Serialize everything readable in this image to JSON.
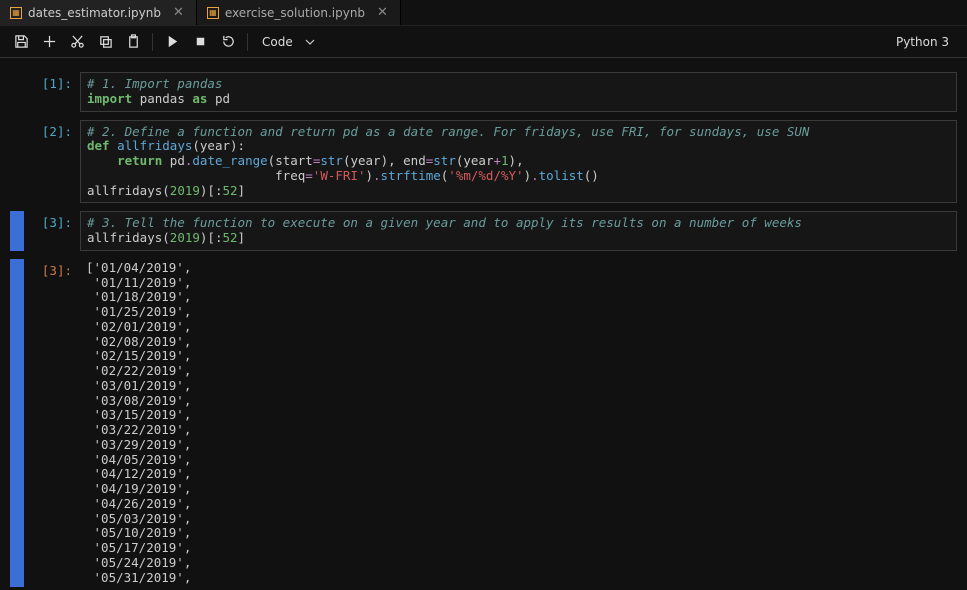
{
  "tabs": [
    {
      "label": "dates_estimator.ipynb",
      "active": true
    },
    {
      "label": "exercise_solution.ipynb",
      "active": false
    }
  ],
  "toolbar": {
    "celltype": "Code",
    "kernel": "Python 3"
  },
  "cells": [
    {
      "prompt": "[1]:",
      "active": false,
      "tokens": [
        [
          [
            "# 1. Import pandas",
            "c-comment"
          ]
        ],
        [
          [
            "import",
            "c-kw"
          ],
          [
            " ",
            "c-def"
          ],
          [
            "pandas",
            "c-def"
          ],
          [
            " ",
            "c-def"
          ],
          [
            "as",
            "c-kw"
          ],
          [
            " ",
            "c-def"
          ],
          [
            "pd",
            "c-def"
          ]
        ]
      ]
    },
    {
      "prompt": "[2]:",
      "active": false,
      "tokens": [
        [
          [
            "# 2. Define a function and return pd as a date range. For fridays, use FRI, for sundays, use SUN",
            "c-comment"
          ]
        ],
        [
          [
            "def",
            "c-kw"
          ],
          [
            " ",
            "c-def"
          ],
          [
            "allfridays",
            "c-fn"
          ],
          [
            "(",
            "c-punct"
          ],
          [
            "year",
            "c-def"
          ],
          [
            "):",
            "c-punct"
          ]
        ],
        [
          [
            "    ",
            "c-def"
          ],
          [
            "return",
            "c-kw"
          ],
          [
            " ",
            "c-def"
          ],
          [
            "pd",
            "c-def"
          ],
          [
            ".",
            "c-op"
          ],
          [
            "date_range",
            "c-attr"
          ],
          [
            "(",
            "c-punct"
          ],
          [
            "start",
            "c-def"
          ],
          [
            "=",
            "c-op"
          ],
          [
            "str",
            "c-fn"
          ],
          [
            "(",
            "c-punct"
          ],
          [
            "year",
            "c-def"
          ],
          [
            "), ",
            "c-punct"
          ],
          [
            "end",
            "c-def"
          ],
          [
            "=",
            "c-op"
          ],
          [
            "str",
            "c-fn"
          ],
          [
            "(",
            "c-punct"
          ],
          [
            "year",
            "c-def"
          ],
          [
            "+",
            "c-op"
          ],
          [
            "1",
            "c-num"
          ],
          [
            "),",
            "c-punct"
          ]
        ],
        [
          [
            "                         ",
            "c-def"
          ],
          [
            "freq",
            "c-def"
          ],
          [
            "=",
            "c-op"
          ],
          [
            "'W-FRI'",
            "c-str"
          ],
          [
            ")",
            "c-punct"
          ],
          [
            ".",
            "c-op"
          ],
          [
            "strftime",
            "c-attr"
          ],
          [
            "(",
            "c-punct"
          ],
          [
            "'%m/%d/%Y'",
            "c-str"
          ],
          [
            ")",
            "c-punct"
          ],
          [
            ".",
            "c-op"
          ],
          [
            "tolist",
            "c-attr"
          ],
          [
            "()",
            "c-punct"
          ]
        ],
        [
          [
            "allfridays",
            "c-def"
          ],
          [
            "(",
            "c-punct"
          ],
          [
            "2019",
            "c-num"
          ],
          [
            ")[:",
            "c-punct"
          ],
          [
            "52",
            "c-num"
          ],
          [
            "]",
            "c-punct"
          ]
        ]
      ]
    },
    {
      "prompt": "[3]:",
      "active": true,
      "tokens": [
        [
          [
            "# 3. Tell the function to execute on a given year and to apply its results on a number of weeks",
            "c-comment"
          ]
        ],
        [
          [
            "allfridays",
            "c-def"
          ],
          [
            "(",
            "c-punct"
          ],
          [
            "2019",
            "c-num"
          ],
          [
            ")[:",
            "c-punct"
          ],
          [
            "52",
            "c-num"
          ],
          [
            "]",
            "c-punct"
          ]
        ]
      ]
    }
  ],
  "output": {
    "prompt": "[3]:",
    "active": true,
    "lines": [
      "['01/04/2019',",
      " '01/11/2019',",
      " '01/18/2019',",
      " '01/25/2019',",
      " '02/01/2019',",
      " '02/08/2019',",
      " '02/15/2019',",
      " '02/22/2019',",
      " '03/01/2019',",
      " '03/08/2019',",
      " '03/15/2019',",
      " '03/22/2019',",
      " '03/29/2019',",
      " '04/05/2019',",
      " '04/12/2019',",
      " '04/19/2019',",
      " '04/26/2019',",
      " '05/03/2019',",
      " '05/10/2019',",
      " '05/17/2019',",
      " '05/24/2019',",
      " '05/31/2019',"
    ]
  }
}
